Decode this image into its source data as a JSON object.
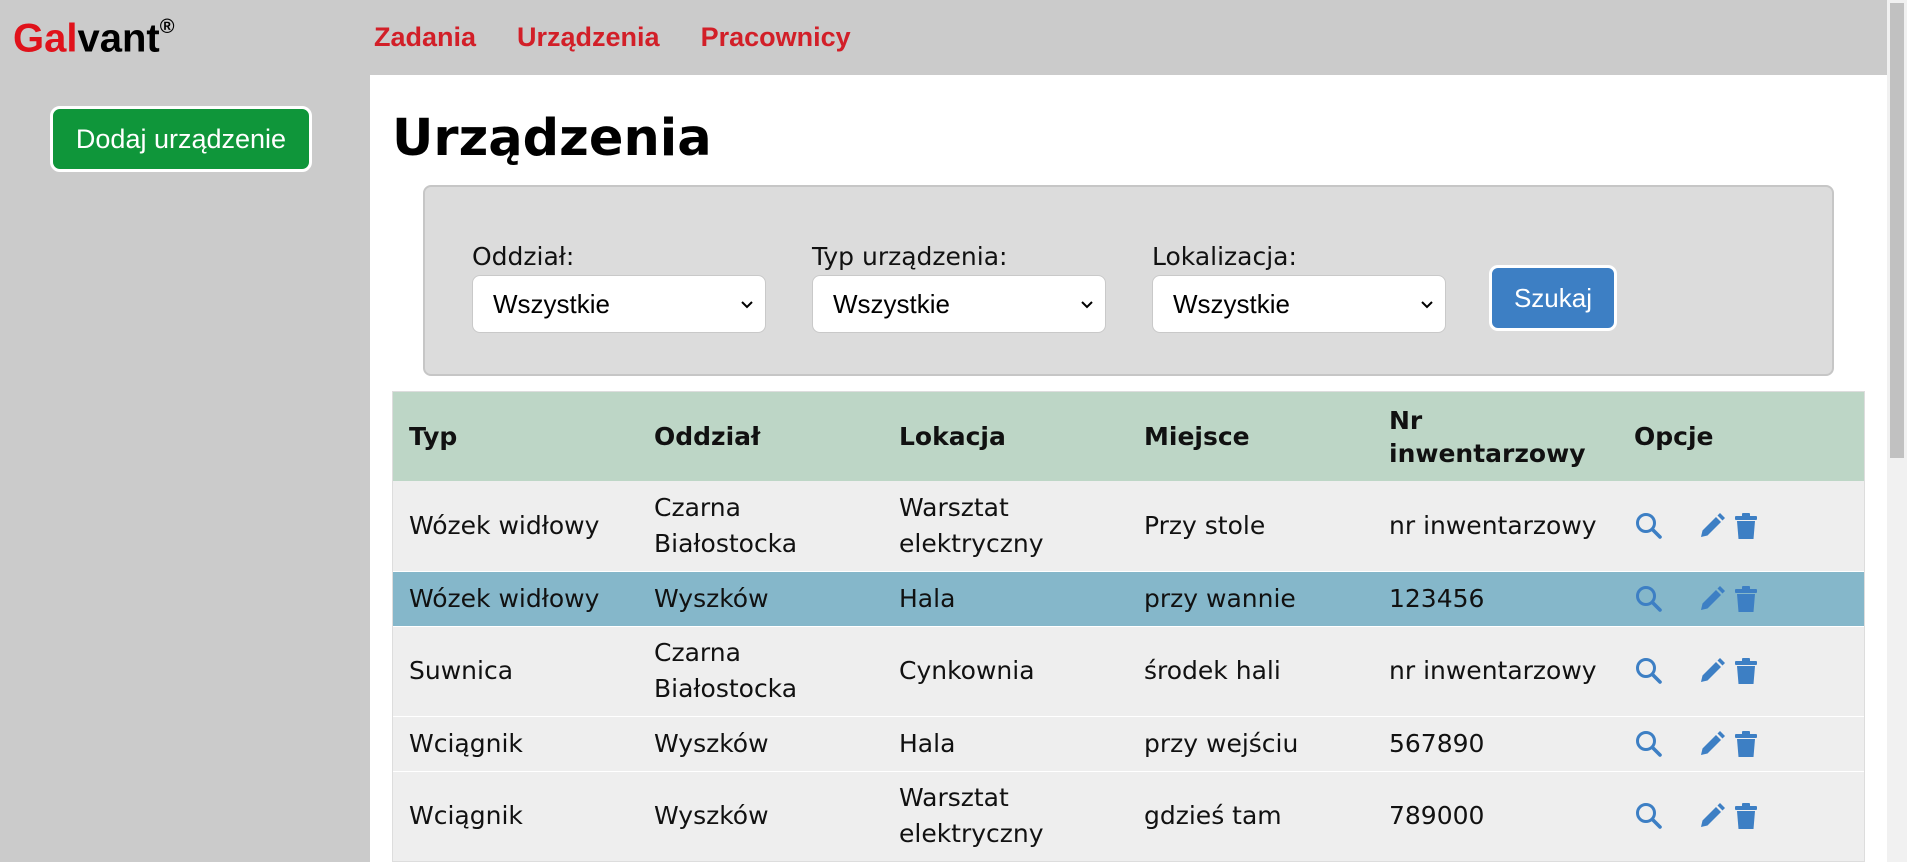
{
  "brand": {
    "part1": "Gal",
    "part2": "vant",
    "mark": "®",
    "accent_color": "#e0121b"
  },
  "nav": {
    "items": [
      {
        "label": "Zadania"
      },
      {
        "label": "Urządzenia"
      },
      {
        "label": "Pracownicy"
      }
    ],
    "color": "#d21f28"
  },
  "sidebar": {
    "add_button_label": "Dodaj urządzenie",
    "add_button_color": "#0f963a"
  },
  "page": {
    "title": "Urządzenia"
  },
  "filters": {
    "department": {
      "label": "Oddział:",
      "value": "Wszystkie"
    },
    "device_type": {
      "label": "Typ urządzenia:",
      "value": "Wszystkie"
    },
    "location": {
      "label": "Lokalizacja:",
      "value": "Wszystkie"
    },
    "search_label": "Szukaj",
    "search_color": "#3d7fc4"
  },
  "table": {
    "headers": {
      "type": "Typ",
      "department": "Oddział",
      "location": "Lokacja",
      "place": "Miejsce",
      "inventory_line1": "Nr",
      "inventory_line2": "inwentarzowy",
      "options": "Opcje"
    },
    "header_color": "#bdd6c6",
    "highlight_color": "#85b7ca",
    "rows": [
      {
        "type": "Wózek widłowy",
        "department": "Czarna Białostocka",
        "location": "Warsztat elektryczny",
        "place": "Przy stole",
        "inventory": "nr inwentarzowy"
      },
      {
        "type": "Wózek widłowy",
        "department": "Wyszków",
        "location": "Hala",
        "place": "przy wannie",
        "inventory": "123456",
        "highlighted": true
      },
      {
        "type": "Suwnica",
        "department": "Czarna Białostocka",
        "location": "Cynkownia",
        "place": "środek hali",
        "inventory": "nr inwentarzowy"
      },
      {
        "type": "Wciągnik",
        "department": "Wyszków",
        "location": "Hala",
        "place": "przy wejściu",
        "inventory": "567890"
      },
      {
        "type": "Wciągnik",
        "department": "Wyszków",
        "location": "Warsztat elektryczny",
        "place": "gdzieś tam",
        "inventory": "789000"
      }
    ],
    "row_icons": [
      "search-icon",
      "pencil-icon",
      "trash-icon"
    ],
    "icon_color": "#3d7fc4"
  }
}
